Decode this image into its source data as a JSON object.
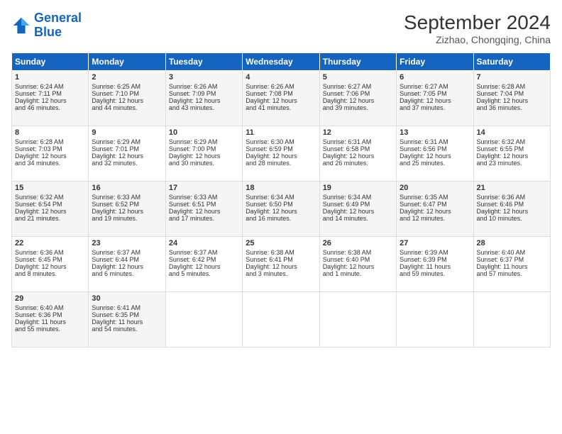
{
  "header": {
    "logo_line1": "General",
    "logo_line2": "Blue",
    "title": "September 2024",
    "subtitle": "Zizhao, Chongqing, China"
  },
  "days_of_week": [
    "Sunday",
    "Monday",
    "Tuesday",
    "Wednesday",
    "Thursday",
    "Friday",
    "Saturday"
  ],
  "weeks": [
    [
      {
        "day": 1,
        "lines": [
          "Sunrise: 6:24 AM",
          "Sunset: 7:11 PM",
          "Daylight: 12 hours",
          "and 46 minutes."
        ]
      },
      {
        "day": 2,
        "lines": [
          "Sunrise: 6:25 AM",
          "Sunset: 7:10 PM",
          "Daylight: 12 hours",
          "and 44 minutes."
        ]
      },
      {
        "day": 3,
        "lines": [
          "Sunrise: 6:26 AM",
          "Sunset: 7:09 PM",
          "Daylight: 12 hours",
          "and 43 minutes."
        ]
      },
      {
        "day": 4,
        "lines": [
          "Sunrise: 6:26 AM",
          "Sunset: 7:08 PM",
          "Daylight: 12 hours",
          "and 41 minutes."
        ]
      },
      {
        "day": 5,
        "lines": [
          "Sunrise: 6:27 AM",
          "Sunset: 7:06 PM",
          "Daylight: 12 hours",
          "and 39 minutes."
        ]
      },
      {
        "day": 6,
        "lines": [
          "Sunrise: 6:27 AM",
          "Sunset: 7:05 PM",
          "Daylight: 12 hours",
          "and 37 minutes."
        ]
      },
      {
        "day": 7,
        "lines": [
          "Sunrise: 6:28 AM",
          "Sunset: 7:04 PM",
          "Daylight: 12 hours",
          "and 36 minutes."
        ]
      }
    ],
    [
      {
        "day": 8,
        "lines": [
          "Sunrise: 6:28 AM",
          "Sunset: 7:03 PM",
          "Daylight: 12 hours",
          "and 34 minutes."
        ]
      },
      {
        "day": 9,
        "lines": [
          "Sunrise: 6:29 AM",
          "Sunset: 7:01 PM",
          "Daylight: 12 hours",
          "and 32 minutes."
        ]
      },
      {
        "day": 10,
        "lines": [
          "Sunrise: 6:29 AM",
          "Sunset: 7:00 PM",
          "Daylight: 12 hours",
          "and 30 minutes."
        ]
      },
      {
        "day": 11,
        "lines": [
          "Sunrise: 6:30 AM",
          "Sunset: 6:59 PM",
          "Daylight: 12 hours",
          "and 28 minutes."
        ]
      },
      {
        "day": 12,
        "lines": [
          "Sunrise: 6:31 AM",
          "Sunset: 6:58 PM",
          "Daylight: 12 hours",
          "and 26 minutes."
        ]
      },
      {
        "day": 13,
        "lines": [
          "Sunrise: 6:31 AM",
          "Sunset: 6:56 PM",
          "Daylight: 12 hours",
          "and 25 minutes."
        ]
      },
      {
        "day": 14,
        "lines": [
          "Sunrise: 6:32 AM",
          "Sunset: 6:55 PM",
          "Daylight: 12 hours",
          "and 23 minutes."
        ]
      }
    ],
    [
      {
        "day": 15,
        "lines": [
          "Sunrise: 6:32 AM",
          "Sunset: 6:54 PM",
          "Daylight: 12 hours",
          "and 21 minutes."
        ]
      },
      {
        "day": 16,
        "lines": [
          "Sunrise: 6:33 AM",
          "Sunset: 6:52 PM",
          "Daylight: 12 hours",
          "and 19 minutes."
        ]
      },
      {
        "day": 17,
        "lines": [
          "Sunrise: 6:33 AM",
          "Sunset: 6:51 PM",
          "Daylight: 12 hours",
          "and 17 minutes."
        ]
      },
      {
        "day": 18,
        "lines": [
          "Sunrise: 6:34 AM",
          "Sunset: 6:50 PM",
          "Daylight: 12 hours",
          "and 16 minutes."
        ]
      },
      {
        "day": 19,
        "lines": [
          "Sunrise: 6:34 AM",
          "Sunset: 6:49 PM",
          "Daylight: 12 hours",
          "and 14 minutes."
        ]
      },
      {
        "day": 20,
        "lines": [
          "Sunrise: 6:35 AM",
          "Sunset: 6:47 PM",
          "Daylight: 12 hours",
          "and 12 minutes."
        ]
      },
      {
        "day": 21,
        "lines": [
          "Sunrise: 6:36 AM",
          "Sunset: 6:46 PM",
          "Daylight: 12 hours",
          "and 10 minutes."
        ]
      }
    ],
    [
      {
        "day": 22,
        "lines": [
          "Sunrise: 6:36 AM",
          "Sunset: 6:45 PM",
          "Daylight: 12 hours",
          "and 8 minutes."
        ]
      },
      {
        "day": 23,
        "lines": [
          "Sunrise: 6:37 AM",
          "Sunset: 6:44 PM",
          "Daylight: 12 hours",
          "and 6 minutes."
        ]
      },
      {
        "day": 24,
        "lines": [
          "Sunrise: 6:37 AM",
          "Sunset: 6:42 PM",
          "Daylight: 12 hours",
          "and 5 minutes."
        ]
      },
      {
        "day": 25,
        "lines": [
          "Sunrise: 6:38 AM",
          "Sunset: 6:41 PM",
          "Daylight: 12 hours",
          "and 3 minutes."
        ]
      },
      {
        "day": 26,
        "lines": [
          "Sunrise: 6:38 AM",
          "Sunset: 6:40 PM",
          "Daylight: 12 hours",
          "and 1 minute."
        ]
      },
      {
        "day": 27,
        "lines": [
          "Sunrise: 6:39 AM",
          "Sunset: 6:39 PM",
          "Daylight: 11 hours",
          "and 59 minutes."
        ]
      },
      {
        "day": 28,
        "lines": [
          "Sunrise: 6:40 AM",
          "Sunset: 6:37 PM",
          "Daylight: 11 hours",
          "and 57 minutes."
        ]
      }
    ],
    [
      {
        "day": 29,
        "lines": [
          "Sunrise: 6:40 AM",
          "Sunset: 6:36 PM",
          "Daylight: 11 hours",
          "and 55 minutes."
        ]
      },
      {
        "day": 30,
        "lines": [
          "Sunrise: 6:41 AM",
          "Sunset: 6:35 PM",
          "Daylight: 11 hours",
          "and 54 minutes."
        ]
      },
      null,
      null,
      null,
      null,
      null
    ]
  ]
}
